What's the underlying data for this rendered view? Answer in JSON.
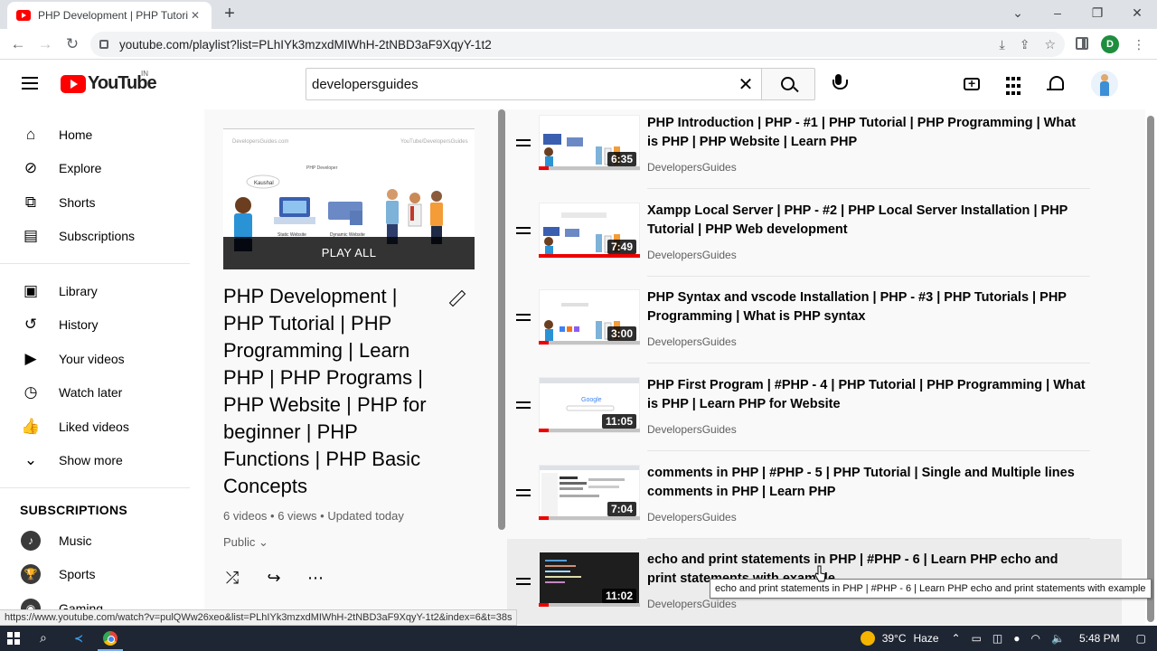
{
  "browser": {
    "tab_title": "PHP Development | PHP Tutorial",
    "new_tab": "+",
    "url": "youtube.com/playlist?list=PLhIYk3mzxdMIWhH-2tNBD3aF9XqyY-1t2",
    "profile_initial": "D",
    "status_url": "https://www.youtube.com/watch?v=pulQWw26xeo&list=PLhIYk3mzxdMIWhH-2tNBD3aF9XqyY-1t2&index=6&t=38s"
  },
  "masthead": {
    "logo": "YouTube",
    "country": "IN",
    "search_query": "developersguides"
  },
  "guide": {
    "main": [
      {
        "label": "Home",
        "icon": "home-icon"
      },
      {
        "label": "Explore",
        "icon": "compass-icon"
      },
      {
        "label": "Shorts",
        "icon": "shorts-icon"
      },
      {
        "label": "Subscriptions",
        "icon": "subscriptions-icon"
      }
    ],
    "library": [
      {
        "label": "Library",
        "icon": "library-icon"
      },
      {
        "label": "History",
        "icon": "history-icon"
      },
      {
        "label": "Your videos",
        "icon": "play-square-icon"
      },
      {
        "label": "Watch later",
        "icon": "clock-icon"
      },
      {
        "label": "Liked videos",
        "icon": "thumb-up-icon"
      },
      {
        "label": "Show more",
        "icon": "chevron-down-icon"
      }
    ],
    "subscriptions_header": "SUBSCRIPTIONS",
    "subscriptions": [
      {
        "label": "Music",
        "icon": "music-icon"
      },
      {
        "label": "Sports",
        "icon": "trophy-icon"
      },
      {
        "label": "Gaming",
        "icon": "gaming-icon"
      }
    ]
  },
  "playlist": {
    "play_all": "PLAY ALL",
    "title": "PHP Development | PHP Tutorial | PHP Programming | Learn PHP | PHP Programs | PHP Website | PHP for beginner | PHP Functions | PHP Basic Concepts",
    "stats": "6 videos • 6 views • Updated today",
    "privacy": "Public",
    "thumb_caption_left": "DevelopersGuides.com",
    "thumb_caption_right": "YouTube/DevelopersGuides",
    "thumb_person_label": "Kaushal",
    "thumb_role_label": "PHP Developer",
    "thumb_static_label": "Static Website",
    "thumb_dynamic_label": "Dynamic Website"
  },
  "videos": [
    {
      "title": "PHP Introduction | PHP - #1 | PHP Tutorial | PHP Programming | What is PHP | PHP Website | Learn PHP",
      "channel": "DevelopersGuides",
      "duration": "6:35",
      "progress": 0.1
    },
    {
      "title": "Xampp Local Server | PHP - #2 | PHP Local Server Installation | PHP Tutorial | PHP Web development",
      "channel": "DevelopersGuides",
      "duration": "7:49",
      "progress": 1.0
    },
    {
      "title": "PHP Syntax and vscode Installation | PHP - #3 | PHP Tutorials | PHP Programming | What is PHP syntax",
      "channel": "DevelopersGuides",
      "duration": "3:00",
      "progress": 0.1
    },
    {
      "title": "PHP First Program | #PHP - 4 | PHP Tutorial | PHP Programming | What is PHP | Learn PHP for Website",
      "channel": "DevelopersGuides",
      "duration": "11:05",
      "progress": 0.1
    },
    {
      "title": "comments in PHP | #PHP - 5 | PHP Tutorial | Single and Multiple lines comments in PHP | Learn PHP",
      "channel": "DevelopersGuides",
      "duration": "7:04",
      "progress": 0.1
    },
    {
      "title": "echo and print statements in PHP | #PHP - 6 | Learn PHP echo and print statements with example",
      "channel": "DevelopersGuides",
      "duration": "11:02",
      "progress": 0.1
    }
  ],
  "tooltip": "echo and print statements in PHP | #PHP - 6 | Learn PHP echo and print statements with example",
  "taskbar": {
    "temperature": "39°C",
    "weather": "Haze",
    "time": "5:48 PM"
  }
}
